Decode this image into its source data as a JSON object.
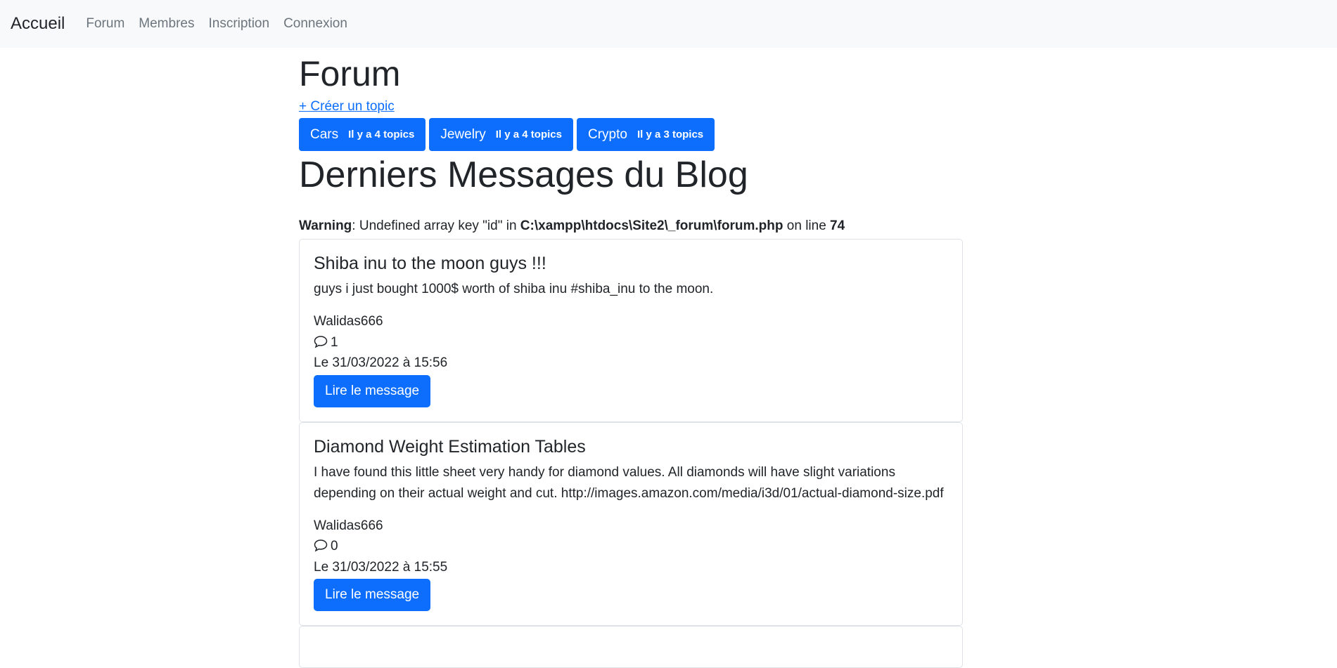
{
  "navbar": {
    "brand": "Accueil",
    "links": [
      "Forum",
      "Membres",
      "Inscription",
      "Connexion"
    ]
  },
  "page_title": "Forum",
  "create_topic": {
    "icon": "plus-icon",
    "label": "Créer un topic"
  },
  "categories": [
    {
      "name": "Cars",
      "count": "Il y a 4 topics"
    },
    {
      "name": "Jewelry",
      "count": "Il y a 4 topics"
    },
    {
      "name": "Crypto",
      "count": "Il y a 3 topics"
    }
  ],
  "blog_title": "Derniers Messages du Blog",
  "warning": {
    "label": "Warning",
    "text1": ": Undefined array key \"id\" in ",
    "file": "C:\\xampp\\htdocs\\Site2\\_forum\\forum.php",
    "text2": " on line ",
    "line": "74"
  },
  "posts": [
    {
      "title": "Shiba inu to the moon guys !!!",
      "body": "guys i just bought 1000$ worth of shiba inu #shiba_inu to the moon.",
      "author": "Walidas666",
      "comments": "1",
      "date": "Le 31/03/2022 à 15:56",
      "button": "Lire le message"
    },
    {
      "title": "Diamond Weight Estimation Tables",
      "body": "I have found this little sheet very handy for diamond values. All diamonds will have slight variations depending on their actual weight and cut. http://images.amazon.com/media/i3d/01/actual-diamond-size.pdf",
      "author": "Walidas666",
      "comments": "0",
      "date": "Le 31/03/2022 à 15:55",
      "button": "Lire le message"
    }
  ],
  "colors": {
    "primary": "#0d6efd",
    "navbar_bg": "#f8f9fa",
    "text": "#212529",
    "muted": "#6c757d"
  }
}
